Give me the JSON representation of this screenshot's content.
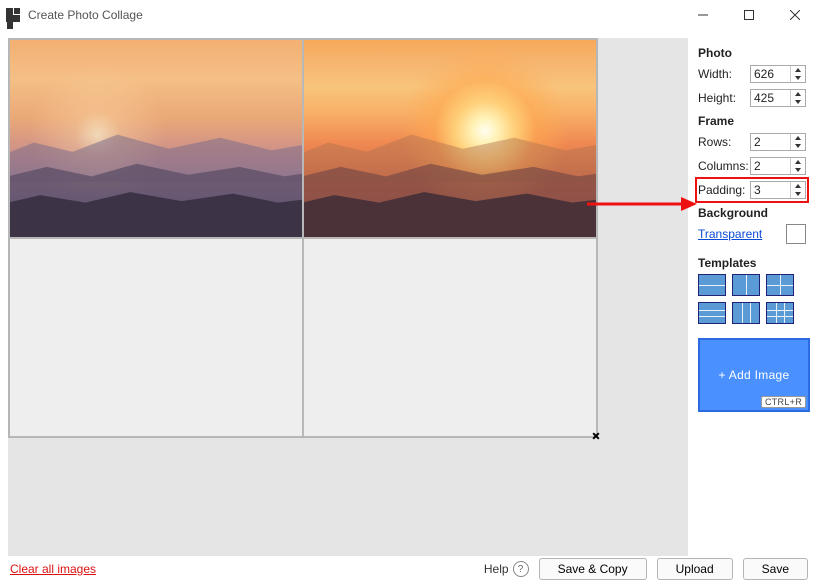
{
  "window": {
    "title": "Create Photo Collage"
  },
  "photo": {
    "heading": "Photo",
    "width_label": "Width:",
    "width_value": "626",
    "height_label": "Height:",
    "height_value": "425"
  },
  "frame": {
    "heading": "Frame",
    "rows_label": "Rows:",
    "rows_value": "2",
    "cols_label": "Columns:",
    "cols_value": "2",
    "pad_label": "Padding:",
    "pad_value": "3"
  },
  "background": {
    "heading": "Background",
    "link": "Transparent"
  },
  "templates": {
    "heading": "Templates"
  },
  "add_image": {
    "label": "+ Add Image",
    "shortcut": "CTRL+R"
  },
  "footer": {
    "clear": "Clear all images",
    "help": "Help",
    "save_copy": "Save & Copy",
    "upload": "Upload",
    "save": "Save"
  }
}
